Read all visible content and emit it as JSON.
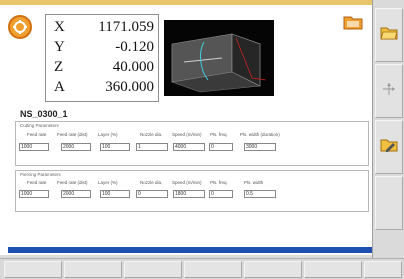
{
  "coordinates": [
    {
      "axis": "X",
      "value": "1171.059"
    },
    {
      "axis": "Y",
      "value": "-0.120"
    },
    {
      "axis": "Z",
      "value": "40.000"
    },
    {
      "axis": "A",
      "value": "360.000"
    }
  ],
  "program": {
    "name": "NS_0300_1"
  },
  "group_a": {
    "label": "Cutting Parameters",
    "headers": [
      "Feed rate",
      "Feed rate (dist)",
      "Layer (%)",
      "Nozzle dia.",
      "Speed (m/min)",
      "Pls. freq.",
      "Pls. width (duration)"
    ],
    "values": [
      "1000",
      "2000",
      "100",
      "1",
      "4000",
      "0",
      "3000"
    ]
  },
  "group_b": {
    "label": "Piercing Parameters",
    "headers": [
      "Feed rate",
      "Feed rate (dist)",
      "Layer (%)",
      "Nozzle dia.",
      "Speed (m/min)",
      "Pls. freq.",
      "Pls. width"
    ],
    "values": [
      "1000",
      "2000",
      "100",
      "0",
      "1800",
      "0",
      "0.5"
    ]
  },
  "icons": {
    "logo": "gear-logo-icon",
    "open": "folder-icon",
    "side": [
      "folder-open-icon",
      "axis-move-icon",
      "folder-edit-icon"
    ]
  },
  "colors": {
    "accent": "#e8c46a",
    "progress": "#1e50b4",
    "logo": "#f0a030"
  }
}
